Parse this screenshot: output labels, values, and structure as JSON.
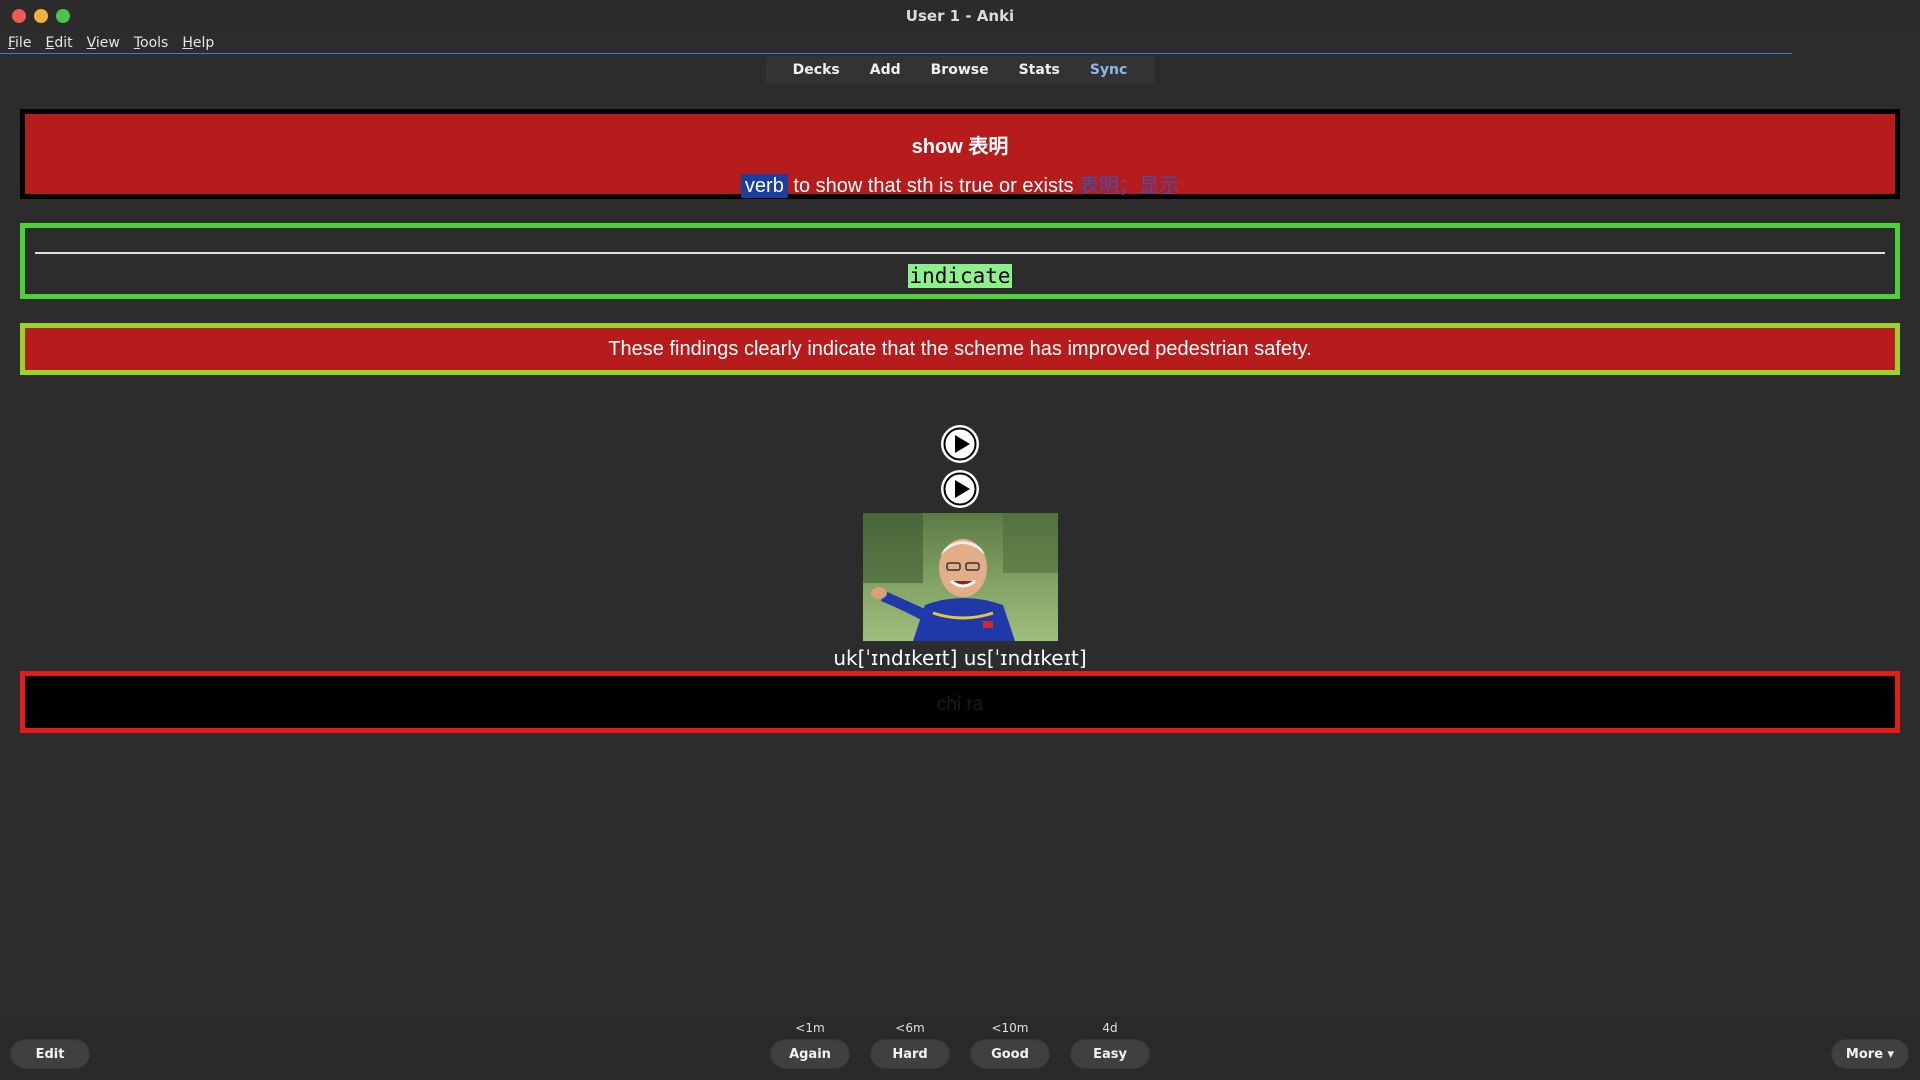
{
  "window": {
    "title": "User 1 - Anki"
  },
  "menu": [
    "File",
    "Edit",
    "View",
    "Tools",
    "Help"
  ],
  "toolbar": [
    "Decks",
    "Add",
    "Browse",
    "Stats",
    "Sync"
  ],
  "card": {
    "word_heading": "show 表明",
    "part_of_speech": "verb",
    "definition": " to show that sth is true or exists ",
    "definition_cn": "表明；显示",
    "answer": "indicate",
    "example": "These findings clearly indicate that the scheme has improved pedestrian safety.",
    "phonetic": "uk[ˈɪndɪkeɪt] us[ˈɪndɪkeɪt]",
    "translation": "chỉ ra"
  },
  "review": {
    "edit_label": "Edit",
    "more_label": "More ▾",
    "answers": [
      {
        "label": "Again",
        "interval": "<1m"
      },
      {
        "label": "Hard",
        "interval": "<6m"
      },
      {
        "label": "Good",
        "interval": "<10m"
      },
      {
        "label": "Easy",
        "interval": "4d"
      }
    ]
  },
  "colors": {
    "card_red": "#b71c1c",
    "answer_border": "#4cd137",
    "example_border": "#9ad12b",
    "translation_border": "#e31b1b",
    "highlight": "#8ef08a",
    "pos_badge": "#1a3fa0"
  },
  "icons": [
    "close-icon",
    "minimize-icon",
    "maximize-icon",
    "play-icon"
  ]
}
